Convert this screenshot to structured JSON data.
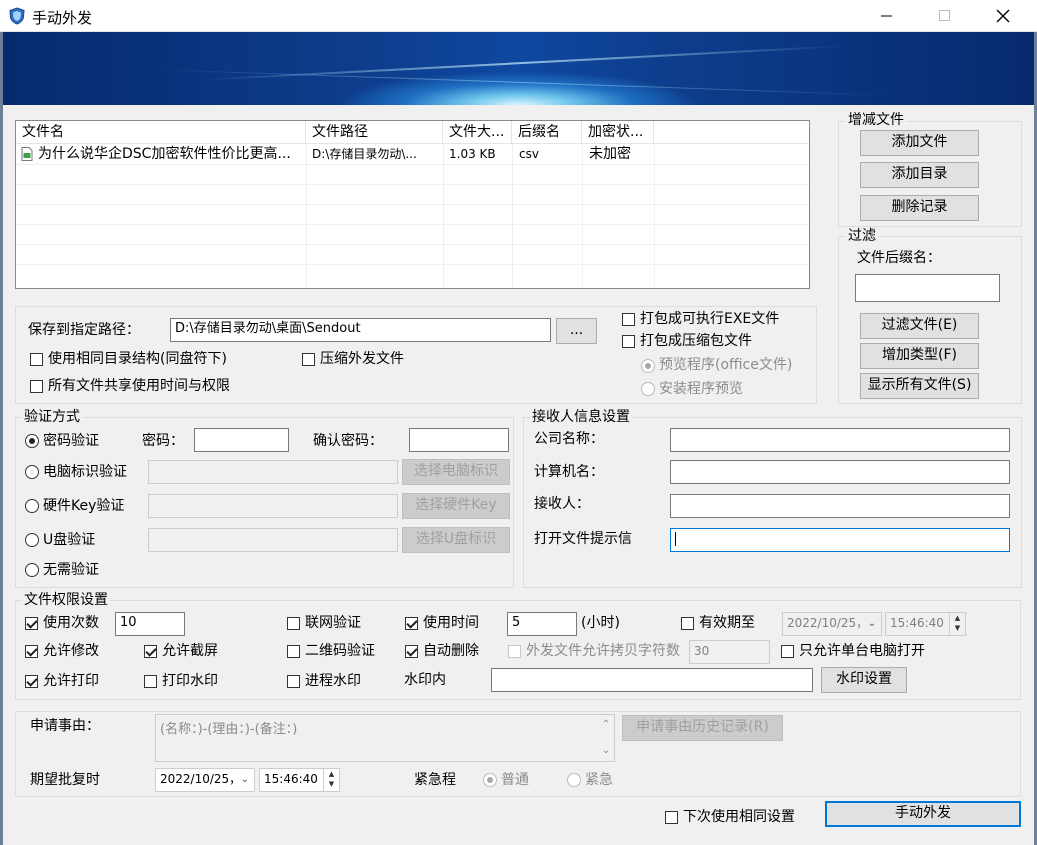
{
  "window": {
    "title": "手动外发"
  },
  "colors": {
    "accent": "#0078d7",
    "banner": "#0d3d8c"
  },
  "file_list": {
    "columns": [
      "文件名",
      "文件路径",
      "文件大...",
      "后缀名",
      "加密状..."
    ],
    "rows": [
      {
        "name": "为什么说华企DSC加密软件性价比更高...",
        "path": "D:\\存储目录勿动\\...",
        "size": "1.03 KB",
        "ext": "csv",
        "status": "未加密",
        "icon": "csv-file-icon"
      }
    ]
  },
  "manage_files": {
    "legend": "增减文件",
    "add_file": "添加文件",
    "add_dir": "添加目录",
    "delete_record": "删除记录"
  },
  "filter": {
    "legend": "过滤",
    "suffix_label": "文件后缀名：",
    "suffix_value": "",
    "filter_files": "过滤文件(E)",
    "add_type": "增加类型(F)",
    "show_all": "显示所有文件(S)"
  },
  "save": {
    "path_label": "保存到指定路径：",
    "path_value": "D:\\存储目录勿动\\桌面\\Sendout",
    "browse": "...",
    "same_dir_structure": "使用相同目录结构(同盘符下)",
    "compress_send": "压缩外发文件",
    "share_time_perms": "所有文件共享使用时间与权限",
    "pack_exe": "打包成可执行EXE文件",
    "pack_zip": "打包成压缩包文件",
    "preview_office": "预览程序(office文件)",
    "install_preview": "安装程序预览"
  },
  "verify": {
    "legend": "验证方式",
    "password": "密码验证",
    "password_label": "密码：",
    "password_value": "",
    "confirm_label": "确认密码：",
    "confirm_value": "",
    "pc_id": "电脑标识验证",
    "pc_id_btn": "选择电脑标识",
    "hw_key": "硬件Key验证",
    "hw_key_btn": "选择硬件Key",
    "usb": "U盘验证",
    "usb_btn": "选择U盘标识",
    "none": "无需验证"
  },
  "receiver": {
    "legend": "接收人信息设置",
    "company_label": "公司名称：",
    "company_value": "",
    "computer_label": "计算机名：",
    "computer_value": "",
    "receiver_label": "接收人：",
    "receiver_value": "",
    "prompt_label": "打开文件提示信",
    "prompt_value": ""
  },
  "perms": {
    "legend": "文件权限设置",
    "use_count": "使用次数",
    "use_count_value": "10",
    "online_verify": "联网验证",
    "use_time": "使用时间",
    "use_time_value": "5",
    "hours_unit": "(小时)",
    "expire": "有效期至",
    "expire_date": "2022/10/25，",
    "expire_time": "15:46:40",
    "allow_modify": "允许修改",
    "allow_screenshot": "允许截屏",
    "qr_verify": "二维码验证",
    "auto_delete": "自动删除",
    "allow_copy_chars": "外发文件允许拷贝字符数",
    "copy_chars_value": "30",
    "single_pc": "只允许单台电脑打开",
    "allow_print": "允许打印",
    "print_watermark": "打印水印",
    "process_watermark": "进程水印",
    "watermark_label": "水印内",
    "watermark_value": "",
    "watermark_settings": "水印设置"
  },
  "apply": {
    "reason_label": "申请事由：",
    "reason_placeholder": "(名称：)-(理由：)-(备注：)",
    "history_btn": "申请事由历史记录(R)",
    "expect_label": "期望批复时",
    "expect_date": "2022/10/25，",
    "expect_time": "15:46:40",
    "urgency_label": "紧急程",
    "normal": "普通",
    "urgent": "紧急"
  },
  "footer": {
    "same_settings": "下次使用相同设置",
    "send": "手动外发"
  }
}
